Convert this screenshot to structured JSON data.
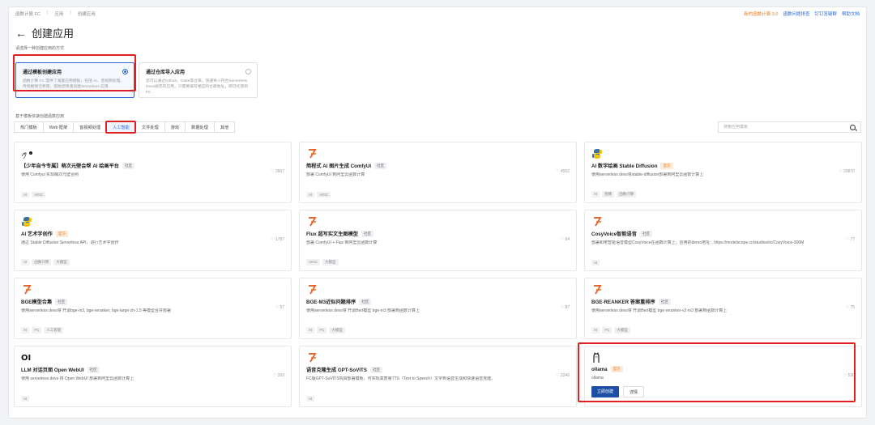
{
  "breadcrumbs": [
    "函数计算 FC",
    "应用",
    "创建应用"
  ],
  "toplinks": [
    {
      "label": "新的函数计算 3.0",
      "color": "orange"
    },
    {
      "label": "函数问题排查",
      "color": "blue"
    },
    {
      "label": "钉钉答疑群",
      "color": "blue"
    },
    {
      "label": "帮助文档",
      "color": "blue"
    }
  ],
  "page_title": "创建应用",
  "choose_label": "请选择一种创建应用的方式",
  "methods": [
    {
      "title": "通过模板创建应用",
      "desc": "函数计算 FC 提供了海量应用模板，包括 AI、音视频处理、传统框架迁移等，帮助您快速创建Serverless 应用"
    },
    {
      "title": "通过仓库导入应用",
      "desc": "您可以通过Github、Gitee等仓库，快速导入符合Serverless Devs规范的应用，只需要填写相应的仓库地址，即可托管到 FC"
    }
  ],
  "section_label": "基于模板快速创建函数应用",
  "tabs": [
    "热门模板",
    "Web 框架",
    "音视频处理",
    "人工智能",
    "文件处理",
    "游戏",
    "数据处理",
    "其他"
  ],
  "search": {
    "placeholder": "搜索应用模板"
  },
  "cards": [
    {
      "title": "【少年自今专属】萌次元壁会帮 AI 绘画平台",
      "badge": "社区",
      "likes": "2607",
      "desc": "使用 Comfyui 实现萌次元壁合照",
      "tags": [
        "AI",
        "AIGC"
      ]
    },
    {
      "title": "简程式 AI 图片生成 ComfyUI",
      "badge": "社区",
      "likes": "4552",
      "desc": "部署 ComfyUI 到阿里云函数计算",
      "tags": [
        "AI",
        "AIGC"
      ]
    },
    {
      "title": "AI 数字绘画 Stable Diffusion",
      "badge": "官方",
      "likes": "29870",
      "desc": "使用serverless devs将stable-diffusion部署到阿里云函数计算上",
      "tags": [
        "AI",
        "图像",
        "函数计算"
      ]
    },
    {
      "title": "AI 艺术字创作",
      "badge": "官方",
      "likes": "1787",
      "desc": "通过 Stable Diffusion Serverless API，进行艺术字创作",
      "tags": [
        "AI",
        "函数计算",
        "大模型"
      ]
    },
    {
      "title": "Flux 超写实文生图模型",
      "badge": "社区",
      "likes": "64",
      "desc": "部署 ComfyUI + Flux 到阿里云函数计算",
      "tags": [
        "AIGC",
        "大模型"
      ]
    },
    {
      "title": "CosyVoice智能语音",
      "badge": "社区",
      "likes": "77",
      "desc": "部署和佬智能语音模型CosyVoice在函数计算上，应用的demo地址：https://modelscope.cn/studios/iic/CosyVoice-300M",
      "tags": [
        "AI"
      ]
    },
    {
      "title": "BGE模型合集",
      "badge": "社区",
      "likes": "57",
      "desc": "使用serverless devs将 开源bge-m3, bge-reranker, bge-large-zh-1.5 等模型合并部署",
      "tags": [
        "AI",
        "FC",
        "人工智能"
      ]
    },
    {
      "title": "BGE-M3近似问题排序",
      "badge": "社区",
      "likes": "87",
      "desc": "使用serverless devs将 开源Bert模型 bge-m3 部署到函数计算上",
      "tags": [
        "AI",
        "FC",
        "大模型"
      ]
    },
    {
      "title": "BGE-REANKER 答案重排序",
      "badge": "社区",
      "likes": "75",
      "desc": "使用serverless devs将 开源Bert模型 bge-reranker-v2-m3 部署到函数计算上",
      "tags": [
        "AI",
        "FC",
        "大模型"
      ]
    },
    {
      "title": "LLM 对话页面 Open WebUI",
      "badge": "社区",
      "likes": "333",
      "desc": "使用 serverless devs 将 Open WebUI 部署到阿里云函数计算上",
      "tags": [
        "AI"
      ]
    },
    {
      "title": "语音克隆生成 GPT-SoVITS",
      "badge": "社区",
      "likes": "2246",
      "desc": "FC版GPT-SoVITS项目部署模板，可实现高质量TTS（Text to Speech）文字到语音生成和快速语音克隆。",
      "tags": [
        "AI"
      ]
    },
    {
      "title": "ollama",
      "badge": "官方",
      "likes": "530",
      "desc": "ollama",
      "create_label": "立即创建",
      "detail_label": "详情"
    }
  ],
  "colors": {
    "accent": "#2b6bd6",
    "primary_button": "#1d4fa6",
    "highlight": "#e02020",
    "official": "#e67e22"
  }
}
